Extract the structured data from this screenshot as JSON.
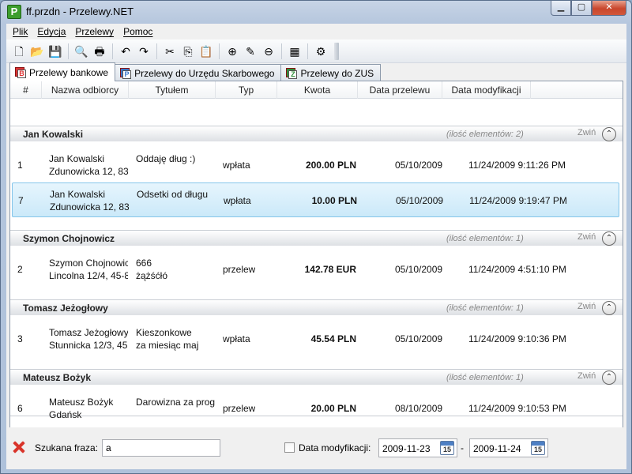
{
  "window": {
    "title": "ff.przdn - Przelewy.NET",
    "app_icon_letter": "P"
  },
  "menu": [
    "Plik",
    "Edycja",
    "Przelewy",
    "Pomoc"
  ],
  "toolbar": [
    {
      "name": "new-document-icon",
      "glyph": "🗋"
    },
    {
      "name": "open-folder-icon",
      "glyph": "📂"
    },
    {
      "name": "save-icon",
      "glyph": "💾"
    },
    {
      "sep": true
    },
    {
      "name": "print-preview-icon",
      "glyph": "🔍"
    },
    {
      "name": "print-icon",
      "glyph": "🖶"
    },
    {
      "sep": true
    },
    {
      "name": "undo-icon",
      "glyph": "↶"
    },
    {
      "name": "redo-icon",
      "glyph": "↷"
    },
    {
      "sep": true
    },
    {
      "name": "cut-icon",
      "glyph": "✂"
    },
    {
      "name": "copy-icon",
      "glyph": "⎘"
    },
    {
      "name": "paste-icon",
      "glyph": "📋"
    },
    {
      "sep": true
    },
    {
      "name": "add-icon",
      "glyph": "⊕"
    },
    {
      "name": "edit-pencil-icon",
      "glyph": "✎"
    },
    {
      "name": "remove-icon",
      "glyph": "⊖"
    },
    {
      "sep": true
    },
    {
      "name": "table-icon",
      "glyph": "▦"
    },
    {
      "sep": true
    },
    {
      "name": "settings-gear-icon",
      "glyph": "⚙"
    }
  ],
  "tabs": [
    {
      "label": "Przelewy bankowe",
      "active": true,
      "icon_letter": "B",
      "icon_color": "#d33"
    },
    {
      "label": "Przelewy do Urzędu Skarbowego",
      "active": false,
      "icon_letter": "P",
      "icon_color": "#3a78c9"
    },
    {
      "label": "Przelewy do ZUS",
      "active": false,
      "icon_letter": "Z",
      "icon_color": "#2e8f3a"
    }
  ],
  "columns": [
    "#",
    "Nazwa odbiorcy",
    "Tytułem",
    "Typ",
    "Kwota",
    "Data przelewu",
    "Data modyfikacji"
  ],
  "collapse_label": "Zwiń",
  "groups": [
    {
      "name": "Jan Kowalski",
      "count": "(ilość elementów: 2)",
      "rows": [
        {
          "num": "1",
          "name1": "Jan Kowalski",
          "name2": "Zdunowicka 12, 83",
          "title1": "Oddaję dług :)",
          "title2": "",
          "type": "wpłata",
          "amount": "200.00 PLN",
          "date": "05/10/2009",
          "mod": "11/24/2009 9:11:26 PM",
          "selected": false
        },
        {
          "num": "7",
          "name1": "Jan Kowalski",
          "name2": "Zdunowicka 12, 83",
          "title1": "Odsetki od długu",
          "title2": "",
          "type": "wpłata",
          "amount": "10.00 PLN",
          "date": "05/10/2009",
          "mod": "11/24/2009 9:19:47 PM",
          "selected": true
        }
      ]
    },
    {
      "name": "Szymon Chojnowicz",
      "count": "(ilość elementów: 1)",
      "rows": [
        {
          "num": "2",
          "name1": "Szymon Chojnowic",
          "name2": "Lincolna 12/4, 45-8",
          "title1": "666",
          "title2": "żążśćłó",
          "type": "przelew",
          "amount": "142.78 EUR",
          "date": "05/10/2009",
          "mod": "11/24/2009 4:51:10 PM",
          "selected": false
        }
      ]
    },
    {
      "name": "Tomasz Jeżogłowy",
      "count": "(ilość elementów: 1)",
      "rows": [
        {
          "num": "3",
          "name1": "Tomasz Jeżogłowy",
          "name2": "Stunnicka 12/3, 45",
          "title1": "Kieszonkowe",
          "title2": "za miesiąc maj",
          "type": "wpłata",
          "amount": "45.54 PLN",
          "date": "05/10/2009",
          "mod": "11/24/2009 9:10:36 PM",
          "selected": false
        }
      ]
    },
    {
      "name": "Mateusz Bożyk",
      "count": "(ilość elementów: 1)",
      "rows": [
        {
          "num": "6",
          "name1": "Mateusz Bożyk",
          "name2": "Gdańsk",
          "title1": "Darowizna za prog",
          "title2": "",
          "type": "przelew",
          "amount": "20.00 PLN",
          "date": "08/10/2009",
          "mod": "11/24/2009 9:10:53 PM",
          "selected": false
        }
      ]
    }
  ],
  "search": {
    "label": "Szukana fraza:",
    "value": "a",
    "mod_date_label": "Data modyfikacji:",
    "mod_date_checked": false,
    "date_from": "2009-11-23",
    "date_to": "2009-11-24",
    "separator": "-",
    "calendar_day": "15"
  }
}
